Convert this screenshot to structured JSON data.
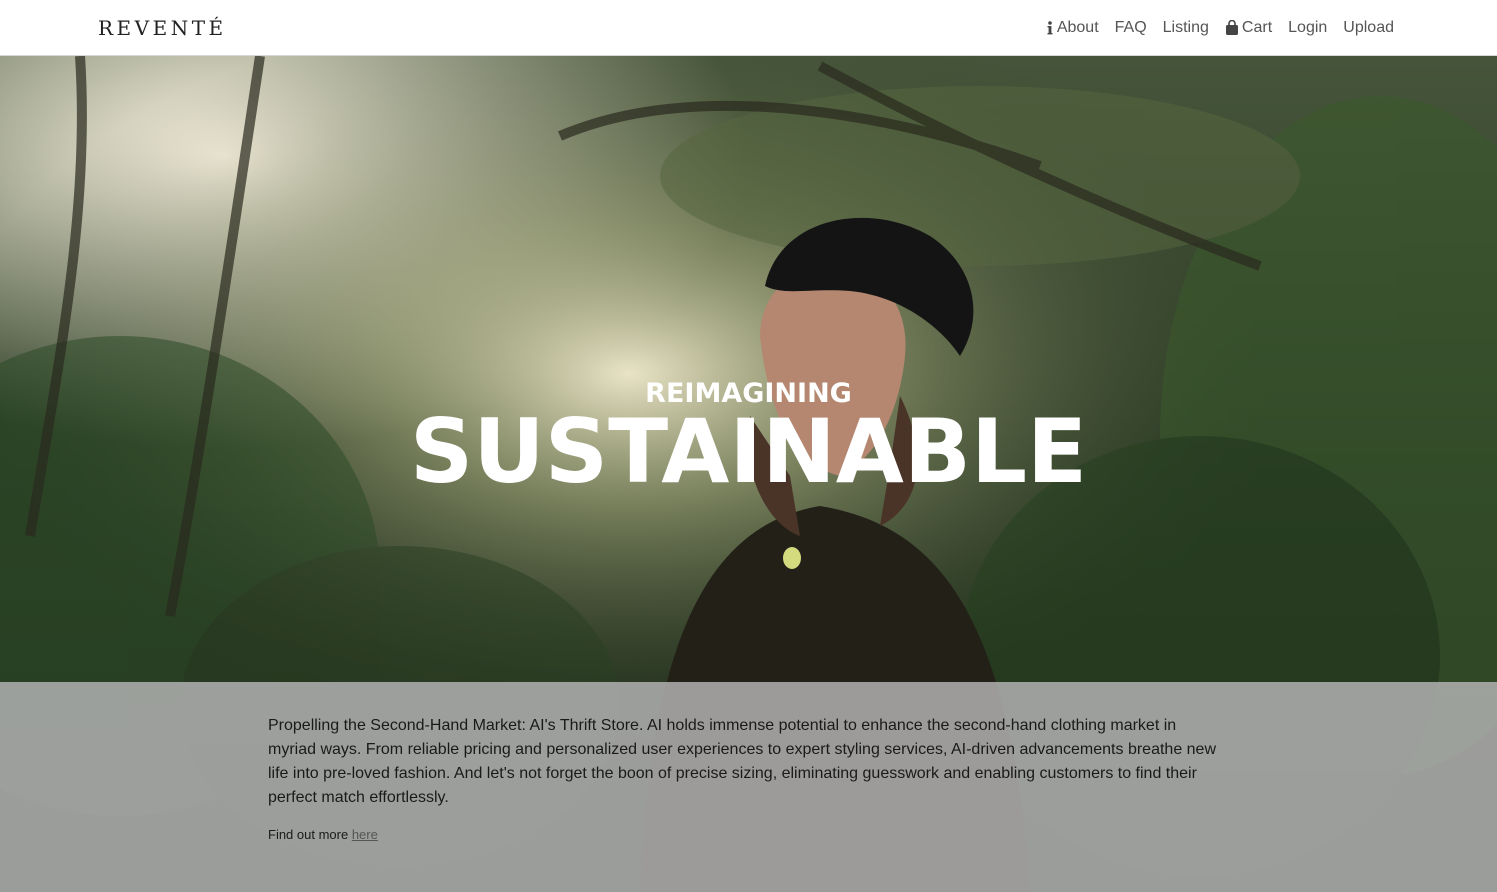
{
  "brand": {
    "name": "REVENTÉ"
  },
  "nav": {
    "about": {
      "label": "About",
      "icon": "info-icon"
    },
    "faq": {
      "label": "FAQ"
    },
    "listing": {
      "label": "Listing"
    },
    "cart": {
      "label": "Cart",
      "icon": "shopping-bag-icon"
    },
    "login": {
      "label": "Login"
    },
    "upload": {
      "label": "Upload"
    }
  },
  "hero": {
    "kicker": "REIMAGINING",
    "title": "SUSTAINABLE",
    "background": "forest-woman-video-background"
  },
  "info": {
    "body": "Propelling the Second-Hand Market: AI's Thrift Store. AI holds immense potential to enhance the second-hand clothing market in myriad ways. From reliable pricing and personalized user experiences to expert styling services, AI-driven advancements breathe new life into pre-loved fashion. And let's not forget the boon of precise sizing, eliminating guesswork and enabling customers to find their perfect match effortlessly.",
    "more_prefix": "Find out more",
    "more_link": "here"
  },
  "colors": {
    "nav_bg": "#ffffff",
    "nav_text": "#555555",
    "headline": "#ffffff",
    "band": "#b0b0b0"
  }
}
